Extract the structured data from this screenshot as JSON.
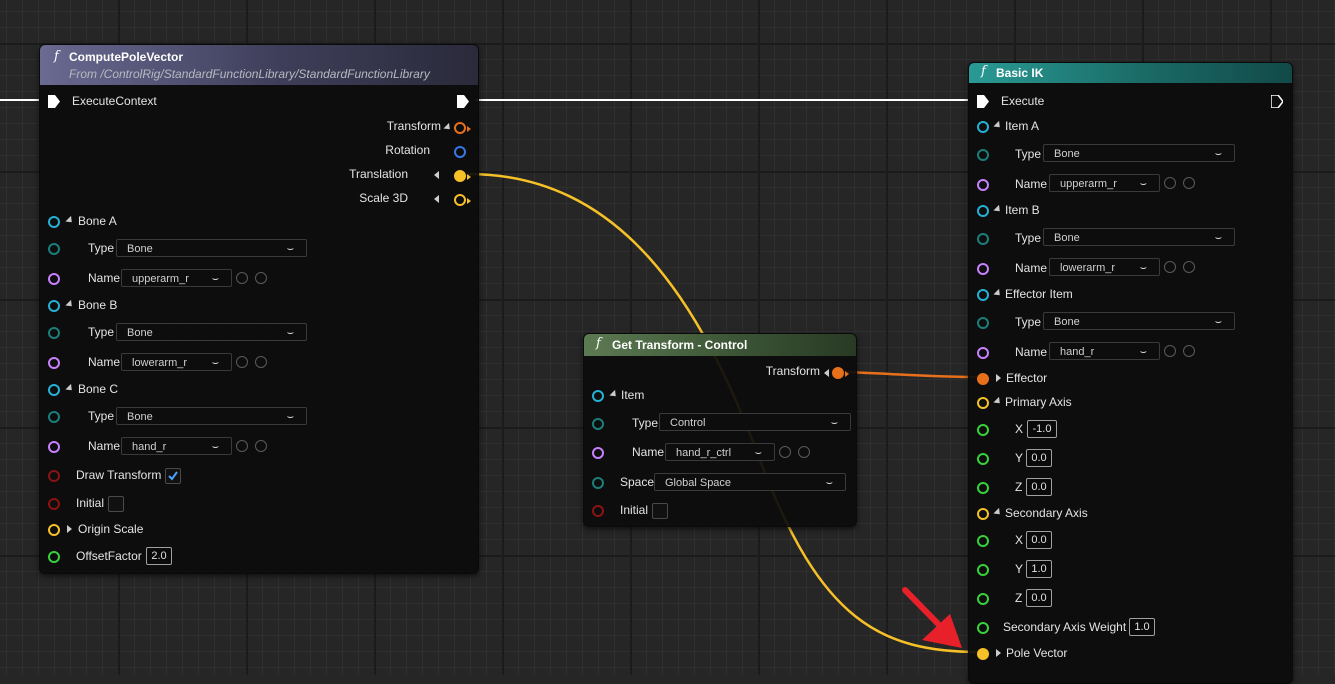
{
  "colors": {
    "exec": "#ffffff",
    "transform": "#e8701a",
    "rotation": "#3b74e6",
    "vector": "#f5c028",
    "item": "#25b1d6",
    "type": "#1a7f7a",
    "name": "#c880ff",
    "bool": "#8a1313",
    "float": "#39d13a",
    "wire_yellow": "#f5c028",
    "wire_orange": "#e8701a",
    "arrow": "#e8202a"
  },
  "compute_pole_vector": {
    "title": "ComputePoleVector",
    "subtitle": "From /ControlRig/StandardFunctionLibrary/StandardFunctionLibrary",
    "execute": "ExecuteContext",
    "outputs": {
      "transform": "Transform",
      "rotation": "Rotation",
      "translation": "Translation",
      "scale": "Scale 3D"
    },
    "bone_a": {
      "label": "Bone A",
      "type_label": "Type",
      "type_value": "Bone",
      "name_label": "Name",
      "name_value": "upperarm_r"
    },
    "bone_b": {
      "label": "Bone B",
      "type_label": "Type",
      "type_value": "Bone",
      "name_label": "Name",
      "name_value": "lowerarm_r"
    },
    "bone_c": {
      "label": "Bone C",
      "type_label": "Type",
      "type_value": "Bone",
      "name_label": "Name",
      "name_value": "hand_r"
    },
    "draw_transform": "Draw Transform",
    "initial": "Initial",
    "origin_scale": "Origin Scale",
    "offset_factor": "OffsetFactor",
    "offset_value": "2.0"
  },
  "get_transform": {
    "title": "Get Transform - Control",
    "output": "Transform",
    "item": "Item",
    "type_label": "Type",
    "type_value": "Control",
    "name_label": "Name",
    "name_value": "hand_r_ctrl",
    "space_label": "Space",
    "space_value": "Global Space",
    "initial": "Initial"
  },
  "basic_ik": {
    "title": "Basic IK",
    "execute": "Execute",
    "item_a": {
      "label": "Item A",
      "type_label": "Type",
      "type_value": "Bone",
      "name_label": "Name",
      "name_value": "upperarm_r"
    },
    "item_b": {
      "label": "Item B",
      "type_label": "Type",
      "type_value": "Bone",
      "name_label": "Name",
      "name_value": "lowerarm_r"
    },
    "effector_item": {
      "label": "Effector Item",
      "type_label": "Type",
      "type_value": "Bone",
      "name_label": "Name",
      "name_value": "hand_r"
    },
    "effector": "Effector",
    "primary_axis": {
      "label": "Primary Axis",
      "x_label": "X",
      "x": "-1.0",
      "y_label": "Y",
      "y": "0.0",
      "z_label": "Z",
      "z": "0.0"
    },
    "secondary_axis": {
      "label": "Secondary Axis",
      "x_label": "X",
      "x": "0.0",
      "y_label": "Y",
      "y": "1.0",
      "z_label": "Z",
      "z": "0.0"
    },
    "secondary_axis_weight": "Secondary Axis Weight",
    "secondary_axis_weight_value": "1.0",
    "pole_vector": "Pole Vector"
  }
}
